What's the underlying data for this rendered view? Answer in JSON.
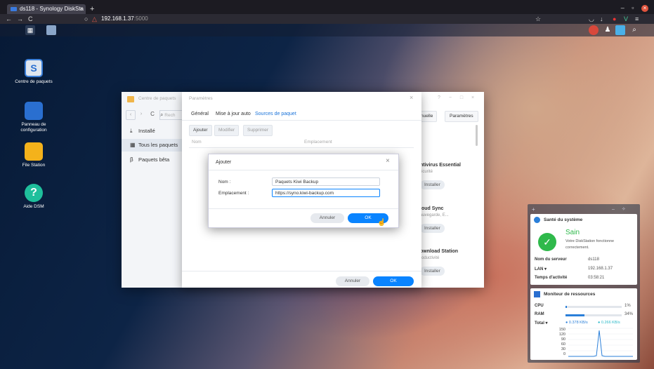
{
  "browser": {
    "tab_title": "ds118 - Synology DiskSta",
    "tab_close": "×",
    "new_tab": "+",
    "url_host": "192.168.1.37",
    "url_port": ":5000"
  },
  "desktop_icons": [
    {
      "name": "package-center",
      "label": "Centre de paquets",
      "color": "#3b7fd9"
    },
    {
      "name": "control-panel",
      "label": "Panneau de configuration",
      "color": "#2a6fd0"
    },
    {
      "name": "file-station",
      "label": "File Station",
      "color": "#f4b21b"
    },
    {
      "name": "dsm-help",
      "label": "Aide DSM",
      "color": "#1fbf9c"
    }
  ],
  "package_center": {
    "title": "Centre de paquets",
    "search_placeholder": "Rech",
    "nav": [
      {
        "label": "Installé",
        "icon": "download-icon"
      },
      {
        "label": "Tous les paquets",
        "icon": "grid-icon"
      },
      {
        "label": "Paquets bêta",
        "icon": "beta-icon"
      }
    ],
    "toolbar": {
      "manual": "nuelle",
      "settings": "Paramètres"
    },
    "cards": [
      {
        "title": "ntivirus Essential",
        "sub": "écurité",
        "button": "Installer"
      },
      {
        "title": "loud Sync",
        "sub": "auvegarde, E...",
        "button": "Installer"
      },
      {
        "title": "ownload Station",
        "sub": "roductivité",
        "button": "Installer"
      }
    ],
    "window_controls": "? − □ ×"
  },
  "params_dialog": {
    "title": "Paramètres",
    "close": "×",
    "tabs": [
      "Général",
      "Mise à jour auto",
      "Sources de paquet"
    ],
    "active_tab": 2,
    "buttons": [
      "Ajouter",
      "Modifier",
      "Supprimer"
    ],
    "columns": [
      "Nom",
      "Emplacement"
    ],
    "cancel": "Annuler",
    "ok": "OK"
  },
  "add_dialog": {
    "title": "Ajouter",
    "close": "×",
    "name_label": "Nom :",
    "name_value": "Paquets Kiwi Backup",
    "location_label": "Emplacement :",
    "location_value": "https://syno.kiwi-backup.com",
    "cancel": "Annuler",
    "ok": "OK"
  },
  "health_widget": {
    "title": "Santé du système",
    "status": "Sain",
    "message": "Votre DiskStation fonctionne correctement.",
    "rows": [
      {
        "label": "Nom du serveur",
        "value": "ds118"
      },
      {
        "label": "LAN ▾",
        "value": "192.168.1.37"
      },
      {
        "label": "Temps d'activité",
        "value": "03:58:21"
      }
    ]
  },
  "resource_widget": {
    "title": "Moniteur de ressources",
    "cpu_label": "CPU",
    "cpu_value": "1%",
    "cpu_pct": 1,
    "ram_label": "RAM",
    "ram_value": "34%",
    "ram_pct": 34,
    "total_label": "Total ▾",
    "up": "0.378 KB/s",
    "down": "0.266 KB/s",
    "graph_ticks": [
      "150",
      "120",
      "90",
      "60",
      "30",
      "0"
    ]
  },
  "colors": {
    "accent": "#0a84ff",
    "ok_green": "#2fb94b"
  }
}
